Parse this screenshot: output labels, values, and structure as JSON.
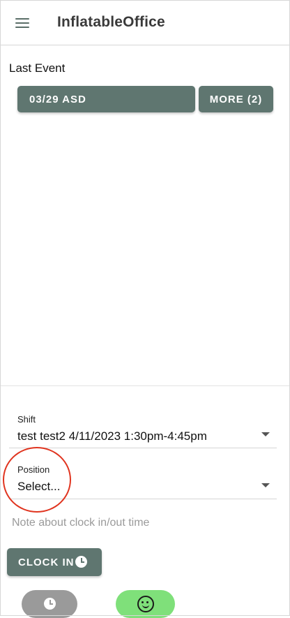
{
  "app": {
    "title": "InflatableOffice"
  },
  "last_event": {
    "label": "Last Event",
    "event_button": "03/29 ASD",
    "more_button": "MORE (2)"
  },
  "shift": {
    "label": "Shift",
    "value": "test test2 4/11/2023 1:30pm-4:45pm"
  },
  "position": {
    "label": "Position",
    "value": "Select..."
  },
  "note": {
    "placeholder": "Note about clock in/out time"
  },
  "clock_in": {
    "label": "CLOCK IN"
  },
  "colors": {
    "primary": "#5f7670",
    "pill_gray": "#9a9a9a",
    "pill_green": "#7fe07a",
    "annotation": "#e0341f"
  },
  "icons": {
    "menu": "menu-icon",
    "clock": "clock-icon",
    "face": "face-scan-icon"
  }
}
